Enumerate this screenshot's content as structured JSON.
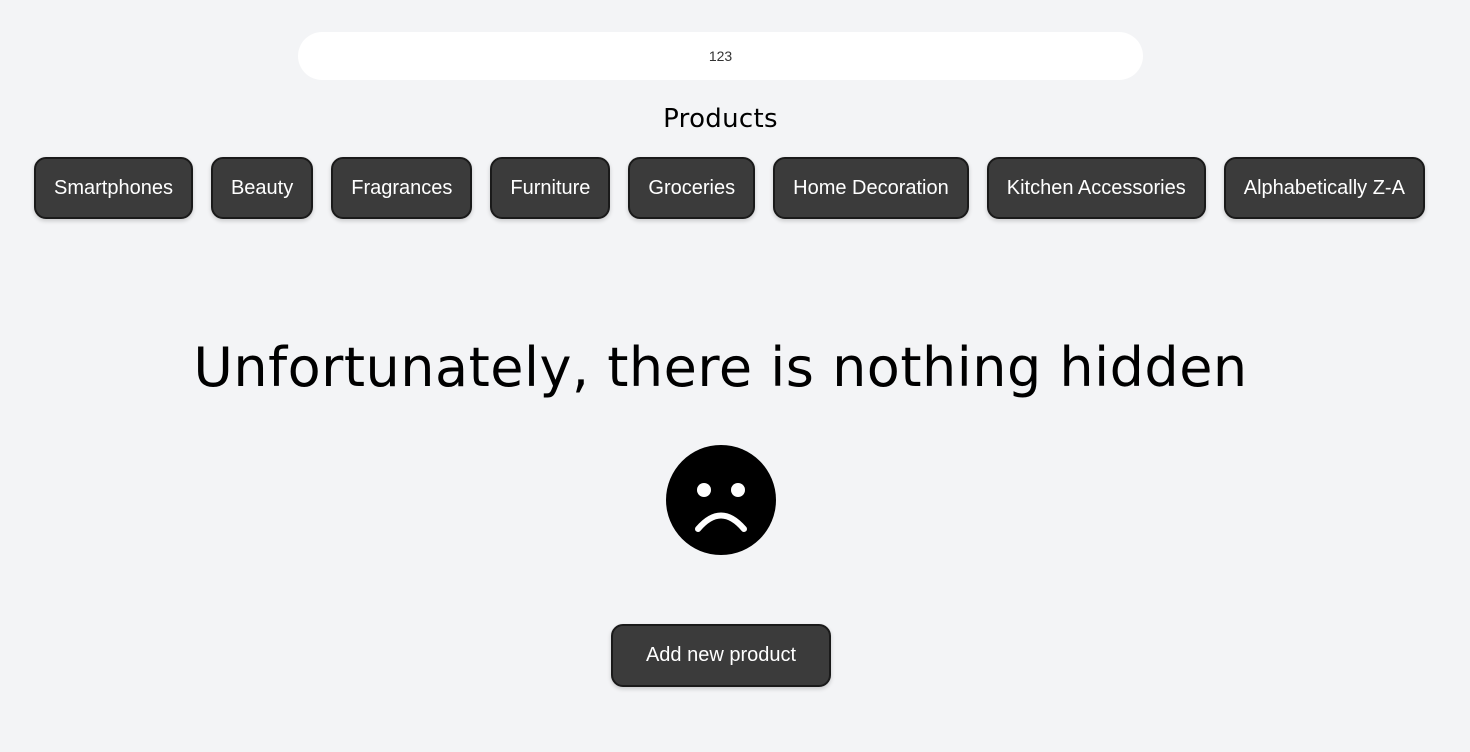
{
  "search": {
    "value": "123"
  },
  "products_section": {
    "title": "Products"
  },
  "categories": [
    {
      "label": "Smartphones"
    },
    {
      "label": "Beauty"
    },
    {
      "label": "Fragrances"
    },
    {
      "label": "Furniture"
    },
    {
      "label": "Groceries"
    },
    {
      "label": "Home Decoration"
    },
    {
      "label": "Kitchen Accessories"
    },
    {
      "label": "Alphabetically Z-A"
    }
  ],
  "empty_state": {
    "message": "Unfortunately, there is nothing hidden",
    "icon": "sad-face-icon"
  },
  "actions": {
    "add_product_label": "Add new product"
  },
  "colors": {
    "background": "#f3f4f6",
    "button_bg": "#3b3b3b",
    "button_text": "#ffffff",
    "search_bg": "#ffffff",
    "text": "#000000"
  }
}
